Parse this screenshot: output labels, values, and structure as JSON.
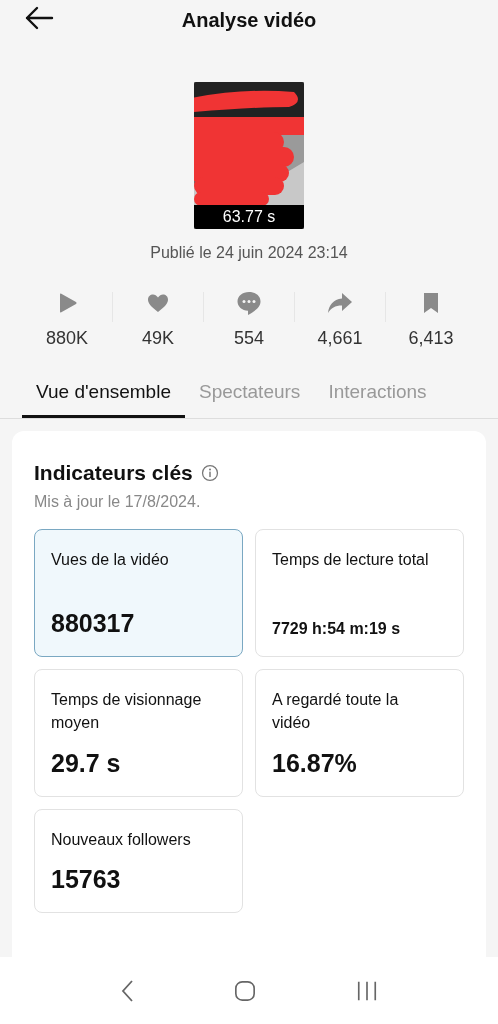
{
  "header": {
    "title": "Analyse vidéo"
  },
  "video": {
    "kind": "picture",
    "duration": "63.77 s",
    "published": "Publié le 24 juin 2024 23:14"
  },
  "stats": [
    {
      "kind": "play",
      "value": "880K"
    },
    {
      "kind": "like",
      "value": "49K"
    },
    {
      "kind": "comment",
      "value": "554"
    },
    {
      "kind": "share",
      "value": "4,661"
    },
    {
      "kind": "save",
      "value": "6,413"
    }
  ],
  "tabs": [
    {
      "label": "Vue d'ensemble",
      "selected": true
    },
    {
      "label": "Spectateurs",
      "selected": false
    },
    {
      "label": "Interactions",
      "selected": false
    }
  ],
  "key_metrics": {
    "title": "Indicateurs clés",
    "updated": "Mis à jour le 17/8/2024.",
    "cards": [
      {
        "label": "Vues de la vidéo",
        "value": "880317",
        "selected": true,
        "kind": "count"
      },
      {
        "label": "Temps de lecture total",
        "value": "7729 h:54 m:19 s",
        "selected": false,
        "kind": "duration"
      },
      {
        "label": "Temps de visionnage moyen",
        "value": "29.7 s",
        "selected": false,
        "kind": "count"
      },
      {
        "label": "A regardé toute la vidéo",
        "value": "16.87%",
        "selected": false,
        "kind": "count"
      },
      {
        "label": "Nouveaux followers",
        "value": "15763",
        "selected": false,
        "kind": "count"
      }
    ]
  }
}
